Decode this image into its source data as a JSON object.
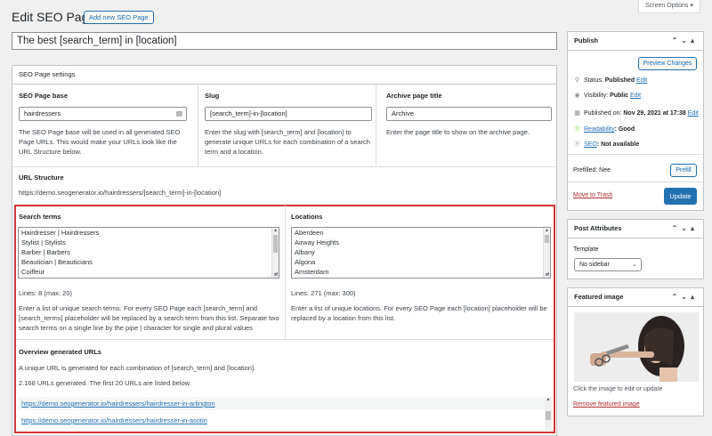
{
  "header": {
    "title": "Edit SEO Page",
    "add_new_label": "Add new SEO Page",
    "screen_options_label": "Screen Options ▾"
  },
  "title_field": {
    "value": "The best [search_term] in [location]"
  },
  "settings": {
    "heading": "SEO Page settings",
    "base": {
      "label": "SEO Page base",
      "value": "hairdressers",
      "description": "The SEO Page base will be used in all generated SEO Page URLs. This would make your URLs look like the URL Structure below."
    },
    "slug": {
      "label": "Slug",
      "value": "[search_term]-in-[location]",
      "description": "Enter the slug with [search_term] and [location] to generate unique URLs for each combination of a search term and a location."
    },
    "archive": {
      "label": "Archive page title",
      "value": "Archive",
      "description": "Enter the page title to show on the archive page."
    },
    "url_structure": {
      "label": "URL Structure",
      "value": "https://demo.seogenerator.io/hairdressers/[search_term]-in-[location]"
    },
    "search_terms": {
      "label": "Search terms",
      "items": [
        "Hairdresser | Hairdressers",
        "Stylist | Stylists",
        "Barber | Barbers",
        "Beautician | Beauticians",
        "Coiffeur"
      ],
      "count": "Lines: 8 (max: 20)",
      "description": "Enter a list of unique search terms. For every SEO Page each [search_term] and [search_terms] placeholder will be replaced by a search term from this list. Separate two search terms on a single line by the pipe | character for single and plural values"
    },
    "locations": {
      "label": "Locations",
      "items": [
        "Aberdeen",
        "Airway Heights",
        "Albany",
        "Algona",
        "Amsterdam"
      ],
      "count": "Lines: 271 (max: 300)",
      "description": "Enter a list of unique locations. For every SEO Page each [location] placeholder will be replaced by a location from this list."
    },
    "overview": {
      "label": "Overview generated URLs",
      "line1": "A unique URL is generated for each combination of [search_term] and [location].",
      "line2": "2.168 URLs generated. The first 20 URLs are listed below.",
      "urls": [
        "https://demo.seogenerator.io/hairdressers/hairdresser-in-arlington",
        "https://demo.seogenerator.io/hairdressers/hairdresser-in-asotin"
      ]
    }
  },
  "publish": {
    "heading": "Publish",
    "preview_label": "Preview Changes",
    "status_label": "Status:",
    "status_value": "Published",
    "visibility_label": "Visibility:",
    "visibility_value": "Public",
    "published_label": "Published on:",
    "published_value": "Nov 29, 2021 at 17:38",
    "edit_label": "Edit",
    "readability_link": "Readability",
    "readability_value": ": Good",
    "seo_link": "SEO",
    "seo_value": ": Not available",
    "prefilled_label": "Prefilled: Nee",
    "prefill_button": "Prefill",
    "trash_label": "Move to Trash",
    "update_label": "Update"
  },
  "attributes": {
    "heading": "Post Attributes",
    "template_label": "Template",
    "template_value": "No sidebar"
  },
  "featured": {
    "heading": "Featured image",
    "hint": "Click the image to edit or update",
    "remove_label": "Remove featured image"
  },
  "colors": {
    "accent": "#2271b1",
    "highlight_border": "#d63638",
    "good_status": "#7ad03a"
  }
}
